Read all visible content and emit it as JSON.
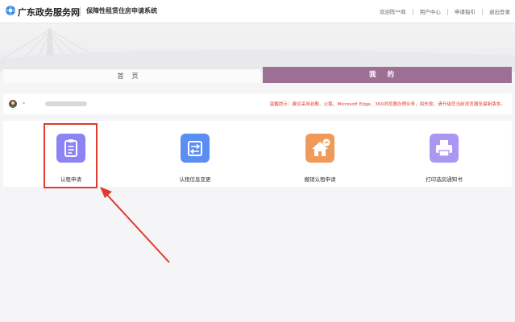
{
  "header": {
    "brand": "广东政务服务网",
    "system_name": "保障性租赁住房申请系统",
    "links": [
      "欢迎陈**商",
      "用户中心",
      "申请指引",
      "退出登录"
    ]
  },
  "nav": {
    "home_tab": "首页",
    "mine_tab": "我的"
  },
  "user": {
    "name_prefix": "*",
    "tip": "温馨提示：建议采用谷歌、火狐、Microsoft Edge、360浏览器办理业务，如失败，请升级您当前浏览器至最新版本。"
  },
  "cards": [
    {
      "label": "认租申请",
      "icon": "clipboard-icon",
      "color": "#8c84f4"
    },
    {
      "label": "认租信息变更",
      "icon": "exchange-icon",
      "color": "#5b8ef2"
    },
    {
      "label": "撤销认租申请",
      "icon": "house-icon",
      "color": "#f09a5a"
    },
    {
      "label": "打印选房通知书",
      "icon": "printer-icon",
      "color": "#a997f2"
    }
  ],
  "colors": {
    "accent_tab": "#9e6f94",
    "tip_red": "#e23a2e",
    "highlight_red": "#e03a2c"
  }
}
